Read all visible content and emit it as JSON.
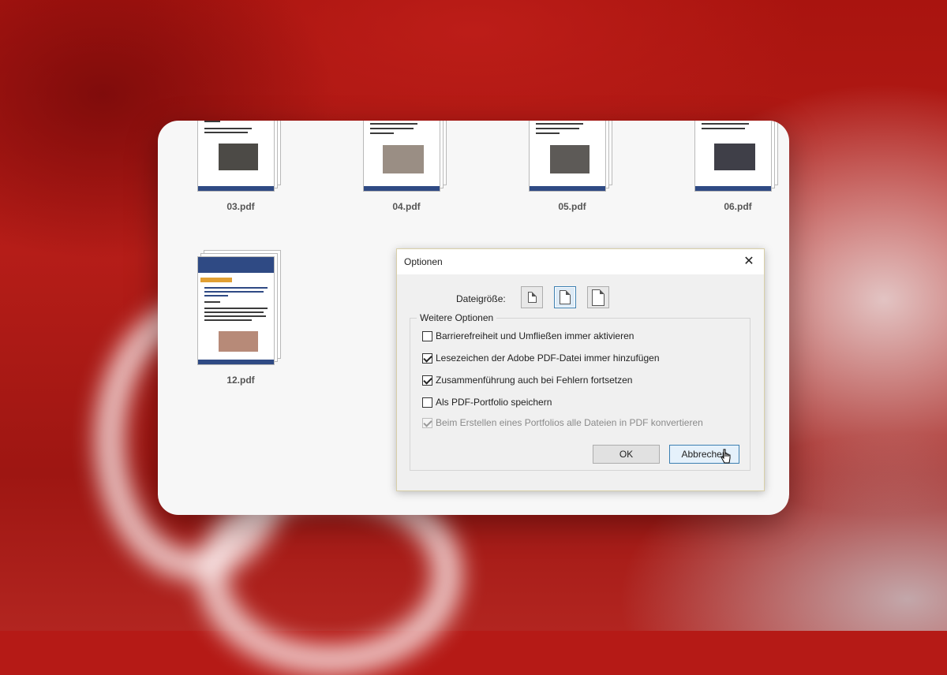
{
  "files": [
    {
      "name": "03.pdf"
    },
    {
      "name": "04.pdf"
    },
    {
      "name": "05.pdf"
    },
    {
      "name": "06.pdf"
    },
    {
      "name": "12.pdf"
    }
  ],
  "dialog": {
    "title": "Optionen",
    "close_icon": "close-icon",
    "file_size": {
      "label": "Dateigröße:",
      "options": [
        "small-document-icon",
        "medium-document-icon",
        "large-document-icon"
      ],
      "selected_index": 1
    },
    "more_options": {
      "legend": "Weitere Optionen",
      "items": [
        {
          "label": "Barrierefreiheit und Umfließen immer aktivieren",
          "checked": false,
          "enabled": true
        },
        {
          "label": "Lesezeichen der Adobe PDF-Datei immer hinzufügen",
          "checked": true,
          "enabled": true
        },
        {
          "label": "Zusammenführung auch bei Fehlern fortsetzen",
          "checked": true,
          "enabled": true
        },
        {
          "label": "Als PDF-Portfolio speichern",
          "checked": false,
          "enabled": true
        },
        {
          "label": "Beim Erstellen eines Portfolios alle Dateien in PDF konvertieren",
          "checked": true,
          "enabled": false
        }
      ]
    },
    "ok_label": "OK",
    "cancel_label": "Abbrechen"
  },
  "colors": {
    "background_red": "#b51a16",
    "pdf_band": "#2f4a84",
    "focus_blue": "#3c7fb1"
  }
}
